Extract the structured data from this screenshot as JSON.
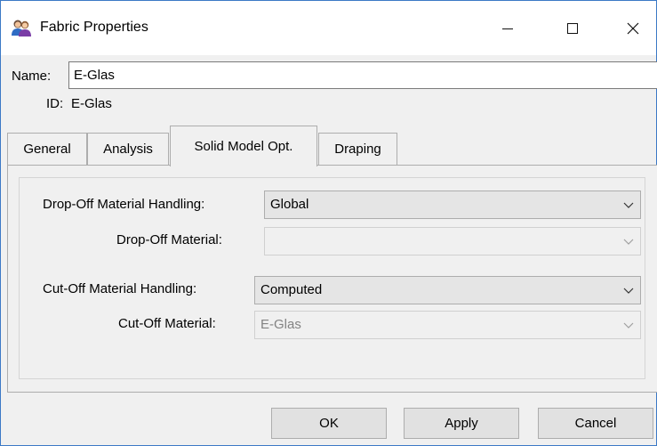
{
  "window": {
    "title": "Fabric Properties",
    "minimize_label": "—",
    "maximize_label": "☐",
    "close_label": "✕"
  },
  "name": {
    "label": "Name:",
    "value": "E-Glas"
  },
  "id": {
    "label": "ID:",
    "value": "E-Glas"
  },
  "tabs": [
    {
      "label": "General"
    },
    {
      "label": "Analysis"
    },
    {
      "label": "Solid Model Opt.",
      "selected": true
    },
    {
      "label": "Draping"
    }
  ],
  "fields": {
    "dropoff_handling": {
      "label": "Drop-Off Material Handling:",
      "value": "Global"
    },
    "dropoff_material": {
      "label": "Drop-Off Material:",
      "value": ""
    },
    "cutoff_handling": {
      "label": "Cut-Off Material Handling:",
      "value": "Computed"
    },
    "cutoff_material": {
      "label": "Cut-Off Material:",
      "value": "E-Glas"
    }
  },
  "buttons": {
    "ok": "OK",
    "apply": "Apply",
    "cancel": "Cancel"
  },
  "icons": {
    "app": "users-icon",
    "dropdown": "chevron-down-icon"
  }
}
